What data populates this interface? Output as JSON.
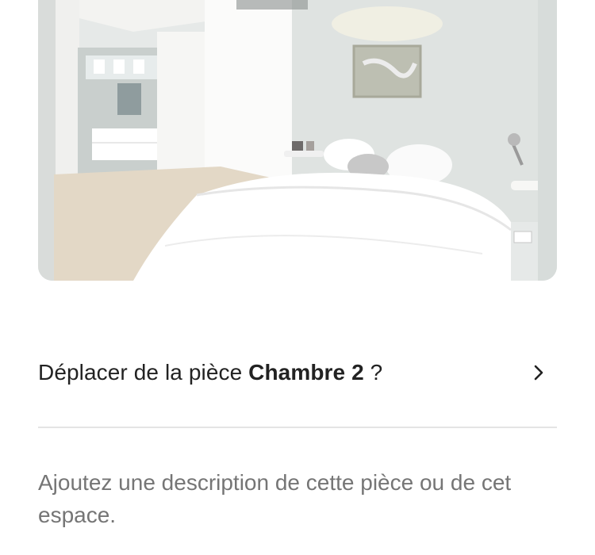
{
  "photo": {
    "icon": "bedroom-photo"
  },
  "move_room": {
    "prefix": "Déplacer de la pièce ",
    "room_name": "Chambre 2",
    "suffix": " ?",
    "icon": "chevron-right-icon"
  },
  "description": {
    "placeholder": "Ajoutez une description de cette pièce ou de cet espace."
  },
  "colors": {
    "text_primary": "#222222",
    "text_secondary": "#717171",
    "divider": "#e4e4e4"
  }
}
